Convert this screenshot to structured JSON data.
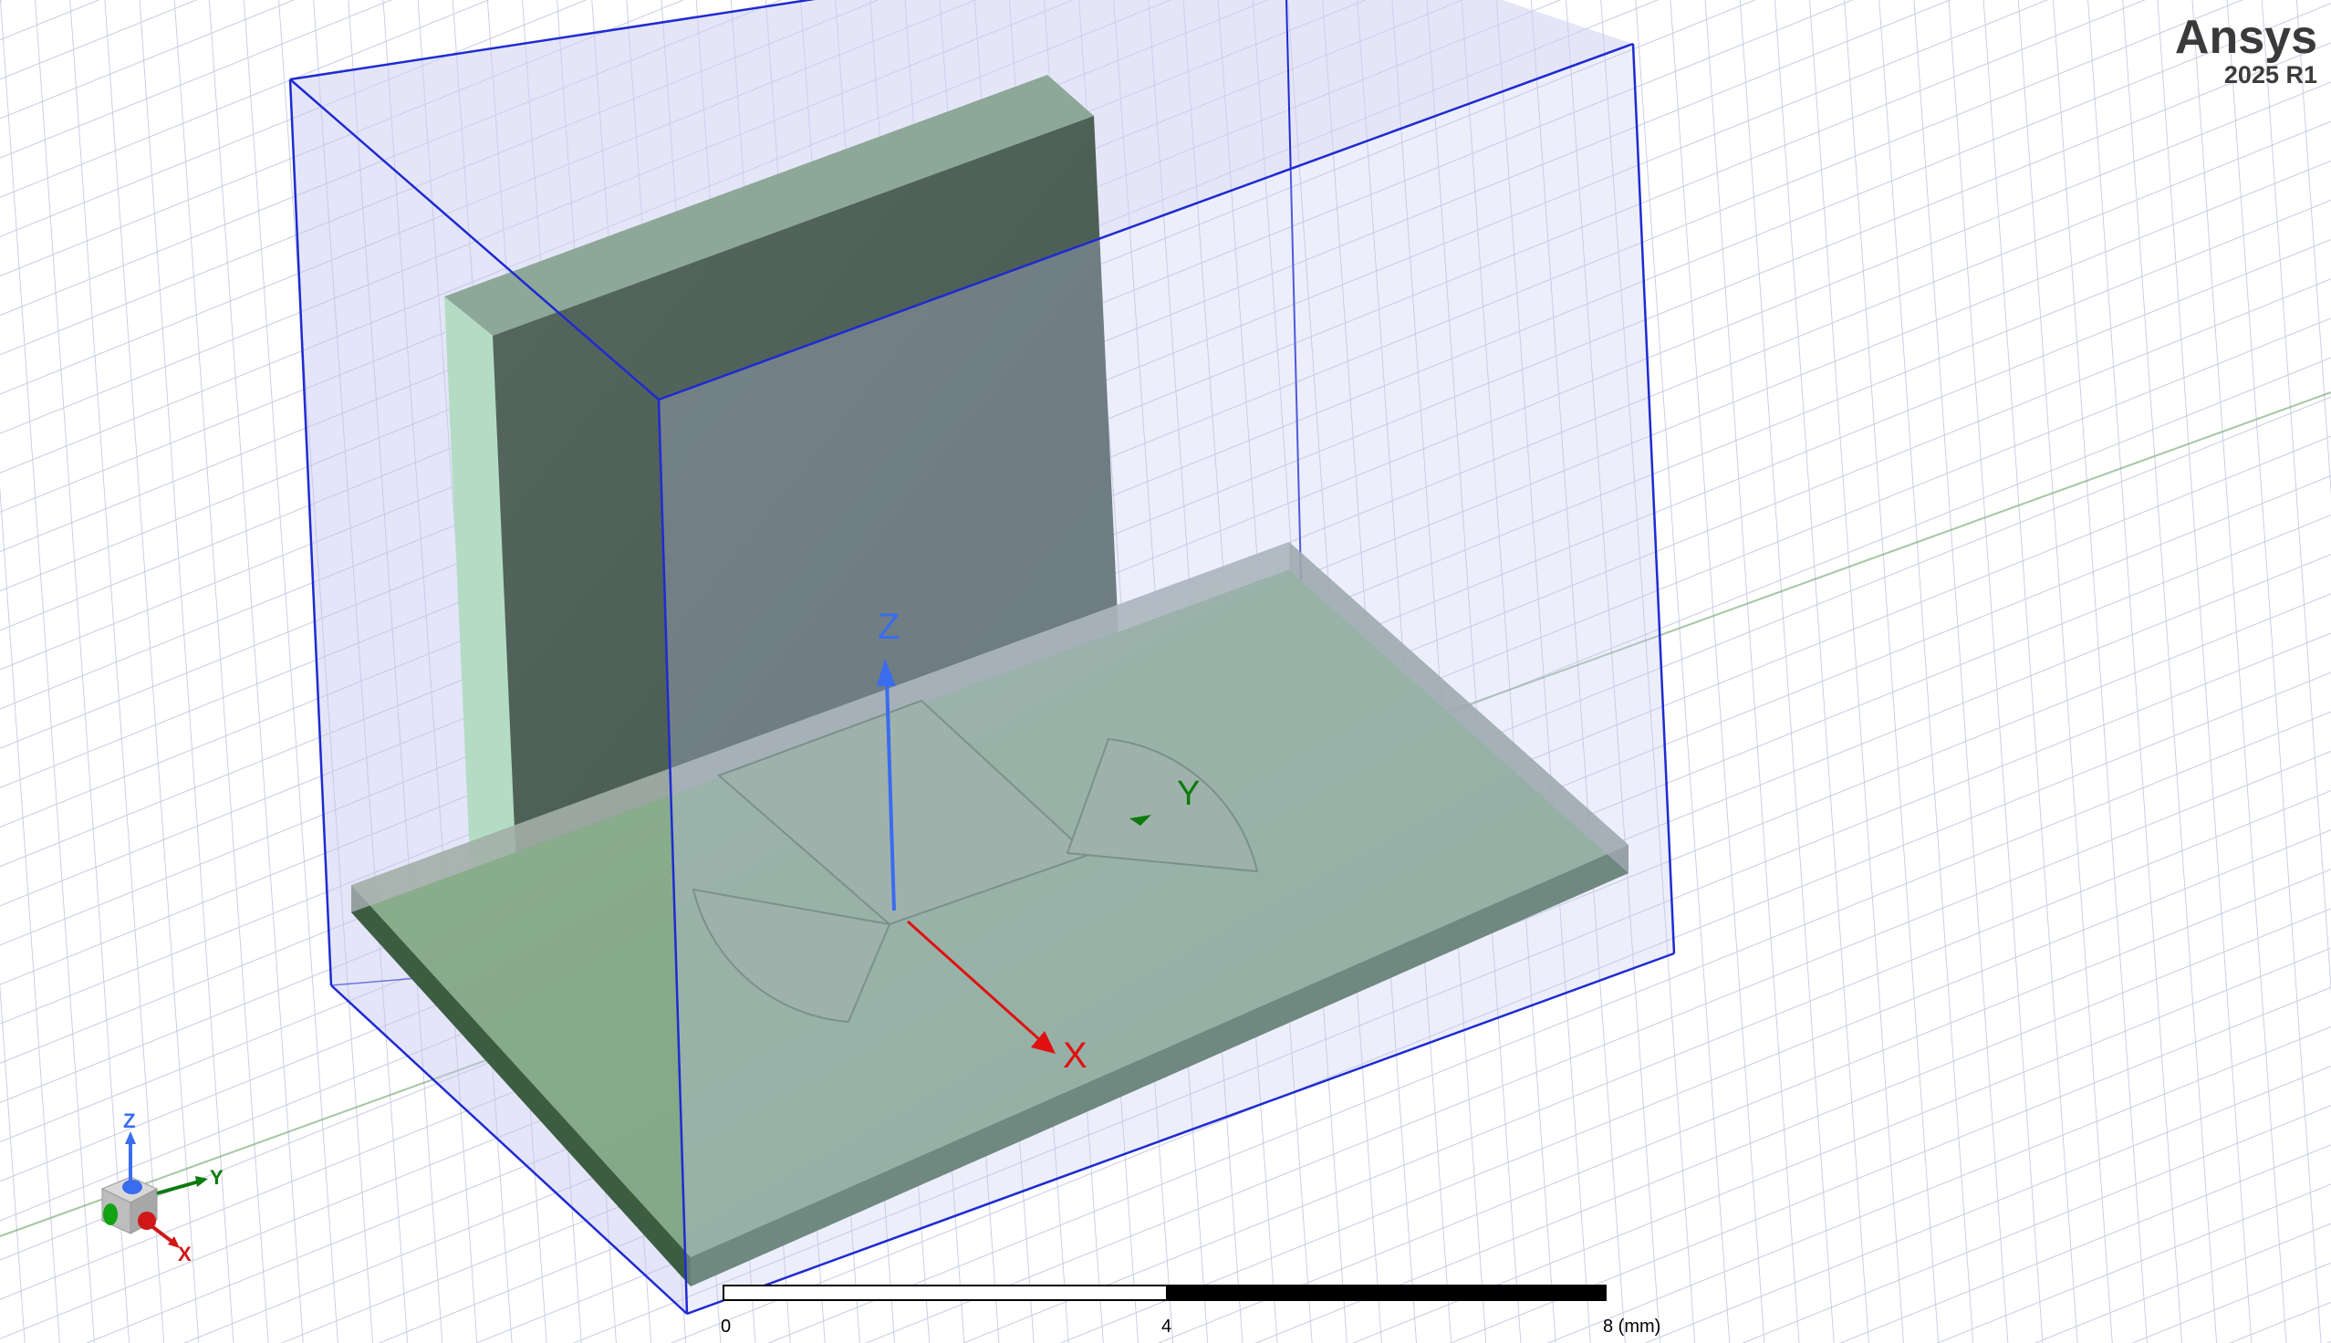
{
  "brand": {
    "name": "Ansys",
    "version": "2025 R1"
  },
  "axes": {
    "x": "X",
    "y": "Y",
    "z": "Z"
  },
  "triad": {
    "x": "X",
    "y": "Y",
    "z": "Z"
  },
  "scale_bar": {
    "ticks": [
      "0",
      "4",
      "8 (mm)"
    ]
  },
  "colors": {
    "background": "#ffffff",
    "grid": "#c7cbe3",
    "region_box": "#1f2bd1",
    "region_fill": "#c8c9f2",
    "substrate_top": "#7ea582",
    "substrate_side": "#4c6b4f",
    "radome_block": "#4f6159",
    "patch": "#8eae8d",
    "x_axis": "#e01010",
    "y_axis": "#0d7a0d",
    "z_axis": "#3a6cf0"
  }
}
